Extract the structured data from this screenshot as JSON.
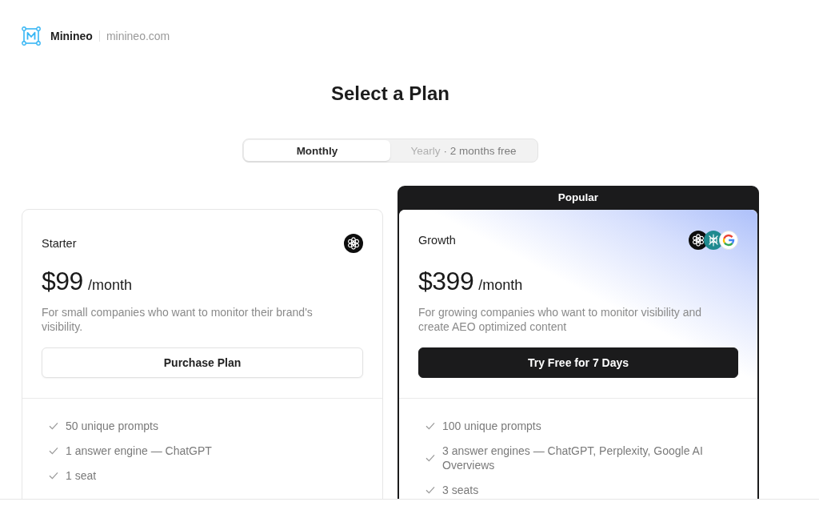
{
  "brand": {
    "name": "Minineo",
    "domain": "minineo.com"
  },
  "title": "Select a Plan",
  "billing_toggle": {
    "options": [
      {
        "label": "Monthly",
        "selected": true
      },
      {
        "label": "Yearly",
        "note": "· 2 months free",
        "selected": false
      }
    ]
  },
  "plans": [
    {
      "name": "Starter",
      "featured": false,
      "engines": [
        {
          "kind": "chatgpt"
        }
      ],
      "price": "$99",
      "period": "/month",
      "description": "For small companies who want to monitor their brand's visibility.",
      "button": {
        "label": "Purchase Plan",
        "kind": "outline"
      },
      "features": [
        "50 unique prompts",
        "1 answer engine — ChatGPT",
        "1 seat"
      ]
    },
    {
      "name": "Growth",
      "featured": true,
      "badge": "Popular",
      "engines": [
        {
          "kind": "chatgpt"
        },
        {
          "kind": "perplexity"
        },
        {
          "kind": "google"
        }
      ],
      "price": "$399",
      "period": "/month",
      "description": "For growing companies who want to monitor visibility and create AEO optimized content",
      "button": {
        "label": "Try Free for 7 Days",
        "kind": "solid"
      },
      "features": [
        "100 unique prompts",
        "3 answer engines — ChatGPT, Perplexity, Google AI Overviews",
        "3 seats"
      ]
    }
  ]
}
